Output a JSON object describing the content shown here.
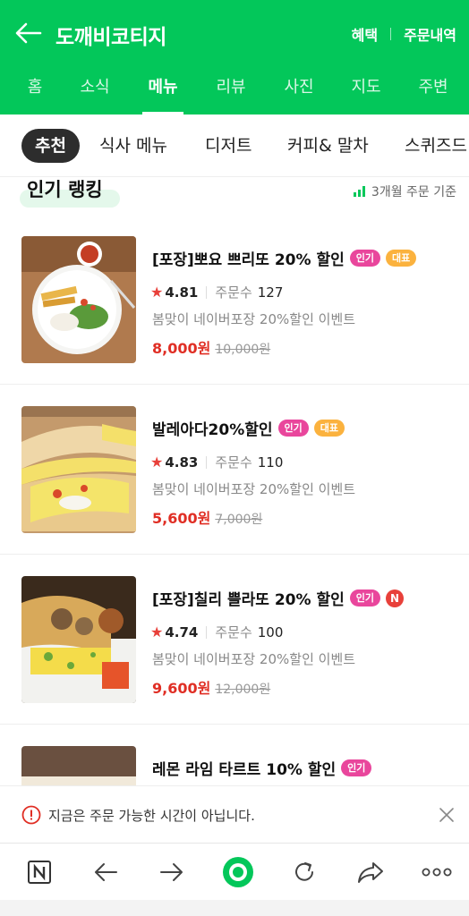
{
  "header": {
    "title": "도깨비코티지",
    "benefit_label": "혜택",
    "orders_label": "주문내역",
    "back_icon": "arrow-left-icon"
  },
  "nav": {
    "tabs": [
      {
        "label": "홈"
      },
      {
        "label": "소식"
      },
      {
        "label": "메뉴"
      },
      {
        "label": "리뷰"
      },
      {
        "label": "사진"
      },
      {
        "label": "지도"
      },
      {
        "label": "주변"
      }
    ],
    "active": "메뉴"
  },
  "chips": {
    "items": [
      {
        "label": "추천"
      },
      {
        "label": "식사 메뉴"
      },
      {
        "label": "디저트"
      },
      {
        "label": "커피& 말차"
      },
      {
        "label": "스퀴즈드"
      }
    ],
    "active": "추천"
  },
  "section": {
    "title": "인기 랭킹",
    "note": "3개월 주문 기준"
  },
  "menu_items": [
    {
      "name": "[포장]뽀요 쁘리또 20% 할인",
      "badges": [
        "인기",
        "대표"
      ],
      "rating": "4.81",
      "order_label": "주문수",
      "order_count": "127",
      "description": "봄맞이 네이버포장 20%할인 이벤트",
      "price": "8,000원",
      "original_price": "10,000원"
    },
    {
      "name": "발레아다20%할인",
      "badges": [
        "인기",
        "대표"
      ],
      "rating": "4.83",
      "order_label": "주문수",
      "order_count": "110",
      "description": "봄맞이 네이버포장 20%할인 이벤트",
      "price": "5,600원",
      "original_price": "7,000원"
    },
    {
      "name": "[포장]칠리 쁠라또 20% 할인",
      "badges": [
        "인기",
        "N"
      ],
      "rating": "4.74",
      "order_label": "주문수",
      "order_count": "100",
      "description": "봄맞이 네이버포장 20%할인 이벤트",
      "price": "9,600원",
      "original_price": "12,000원"
    },
    {
      "name": "레몬 라임 타르트 10% 할인",
      "badges": [
        "인기"
      ]
    }
  ],
  "toast": {
    "message": "지금은 주문 가능한 시간이 아닙니다."
  },
  "bottom_bar": {
    "icons": [
      "naver-n-icon",
      "back-arrow-icon",
      "forward-arrow-icon",
      "green-home-icon",
      "refresh-icon",
      "share-icon",
      "more-icon"
    ]
  },
  "colors": {
    "brand_green": "#03c75a",
    "price_red": "#e02e24",
    "badge_pink": "#e9469c",
    "badge_orange": "#fbb23e"
  }
}
